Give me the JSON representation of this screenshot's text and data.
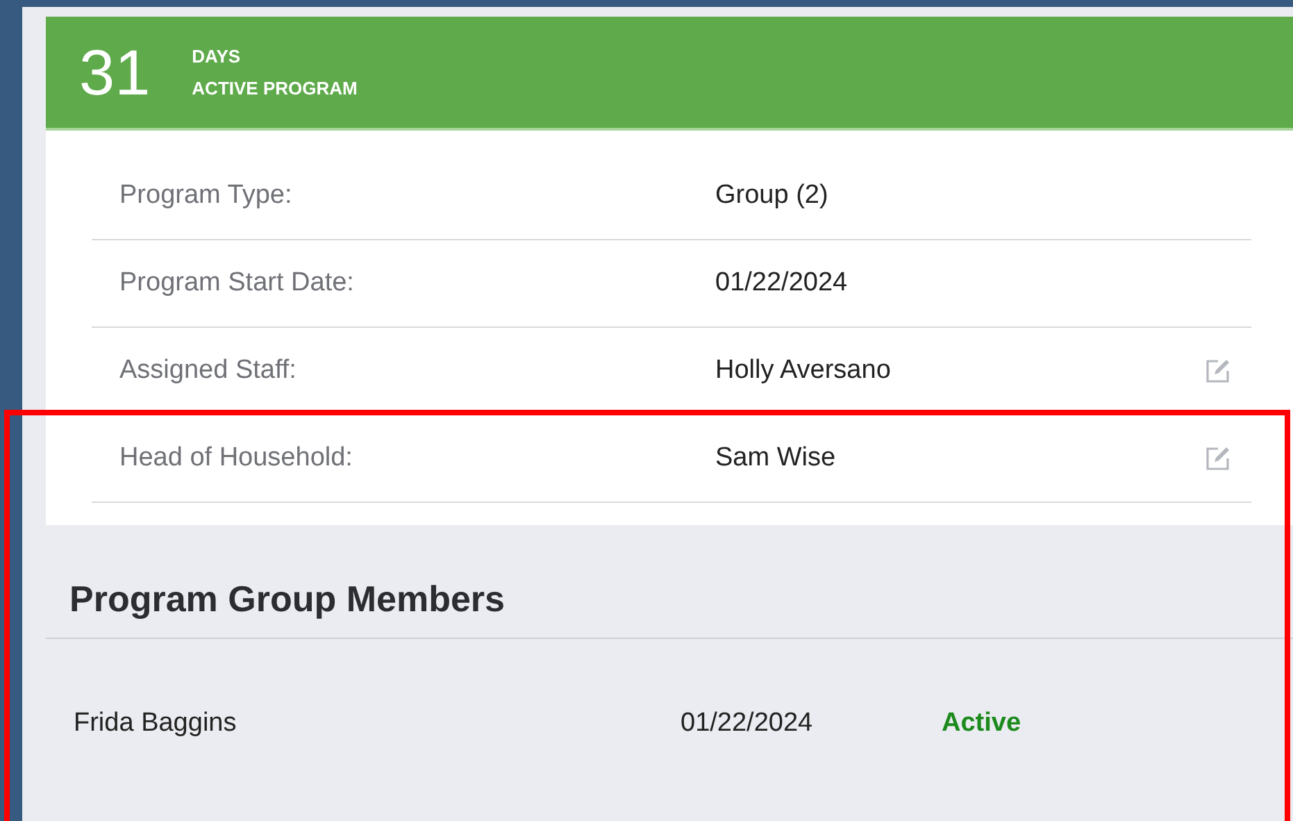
{
  "banner": {
    "count": "31",
    "unit": "DAYS",
    "caption": "ACTIVE PROGRAM"
  },
  "details": [
    {
      "label": "Program Type:",
      "value": "Group (2)",
      "editable": false
    },
    {
      "label": "Program Start Date:",
      "value": "01/22/2024",
      "editable": false
    },
    {
      "label": "Assigned Staff:",
      "value": "Holly Aversano",
      "editable": true
    },
    {
      "label": "Head of Household:",
      "value": "Sam Wise",
      "editable": true
    }
  ],
  "group_members": {
    "title": "Program Group Members",
    "rows": [
      {
        "name": "Frida Baggins",
        "date": "01/22/2024",
        "status": "Active"
      }
    ]
  }
}
